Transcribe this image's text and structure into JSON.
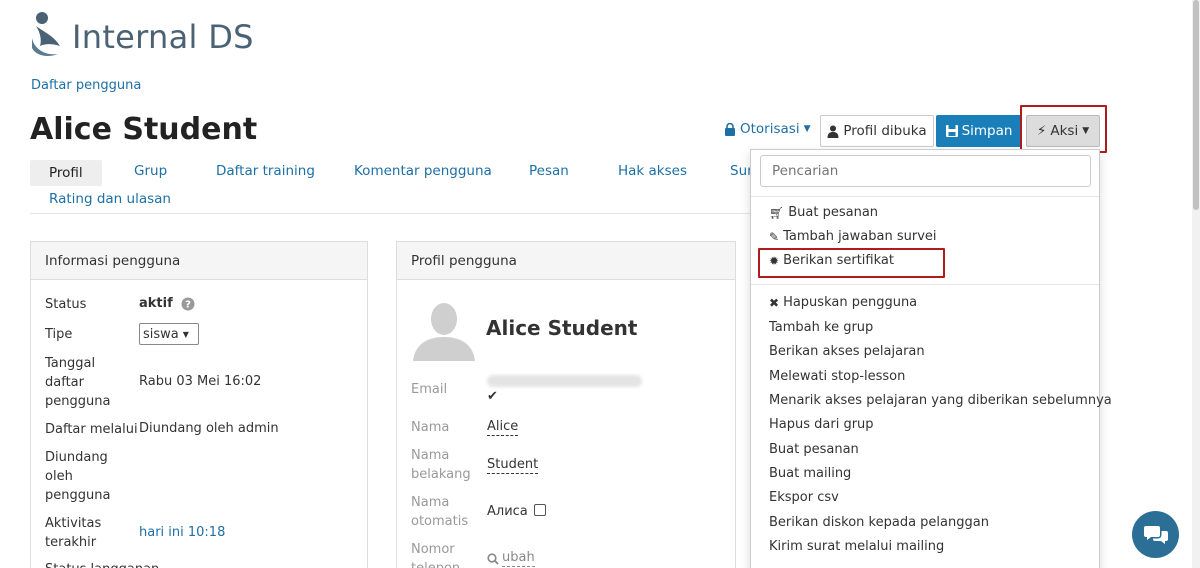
{
  "brand": {
    "name": "Internal DS"
  },
  "breadcrumb": {
    "label": "Daftar pengguna"
  },
  "page": {
    "title": "Alice Student"
  },
  "toolbar": {
    "otorisasi": "Otorisasi",
    "profile_opened": "Profil dibuka",
    "save": "Simpan",
    "actions": "Aksi"
  },
  "tabs": [
    "Profil",
    "Grup",
    "Daftar training",
    "Komentar pengguna",
    "Pesan",
    "Hak akses",
    "Sur",
    "Rating dan ulasan"
  ],
  "user_info": {
    "header": "Informasi pengguna",
    "status_label": "Status",
    "status_value": "aktif",
    "type_label": "Tipe",
    "type_value": "siswa",
    "reg_date_label": "Tanggal daftar pengguna",
    "reg_date_value": "Rabu 03 Mei 16:02",
    "reg_via_label": "Daftar melalui",
    "reg_via_value": "Diundang oleh admin",
    "invited_by_label": "Diundang oleh pengguna",
    "last_activity_label": "Aktivitas terakhir",
    "last_activity_value": "hari ini 10:18",
    "subscription_label": "Status langganan"
  },
  "profile": {
    "header": "Profil pengguna",
    "name": "Alice Student",
    "email_label": "Email",
    "first_name_label": "Nama",
    "first_name_value": "Alice",
    "last_name_label": "Nama belakang",
    "last_name_value": "Student",
    "auto_name_label": "Nama otomatis",
    "auto_name_value": "Алиса",
    "phone_label": "Nomor telepon",
    "phone_value": "ubah"
  },
  "dropdown": {
    "search_placeholder": "Pencarian",
    "group1": [
      {
        "label": "Buat pesanan",
        "icon": "cart-icon"
      },
      {
        "label": "Tambah jawaban survei",
        "icon": "pencil-icon"
      },
      {
        "label": "Berikan sertifikat",
        "icon": "certificate-icon"
      }
    ],
    "group2": [
      {
        "label": "Hapuskan pengguna",
        "icon": "x-icon"
      },
      {
        "label": "Tambah ke grup"
      },
      {
        "label": "Berikan akses pelajaran"
      },
      {
        "label": "Melewati stop-lesson"
      },
      {
        "label": "Menarik akses pelajaran yang diberikan sebelumnya"
      },
      {
        "label": "Hapus dari grup"
      },
      {
        "label": "Buat pesanan"
      },
      {
        "label": "Buat mailing"
      },
      {
        "label": "Ekspor csv"
      },
      {
        "label": "Berikan diskon kepada pelanggan"
      },
      {
        "label": "Kirim surat melalui mailing"
      }
    ]
  },
  "colors": {
    "accent": "#1a7fb8",
    "link": "#1e6fa5",
    "highlight": "#b01c1c"
  }
}
